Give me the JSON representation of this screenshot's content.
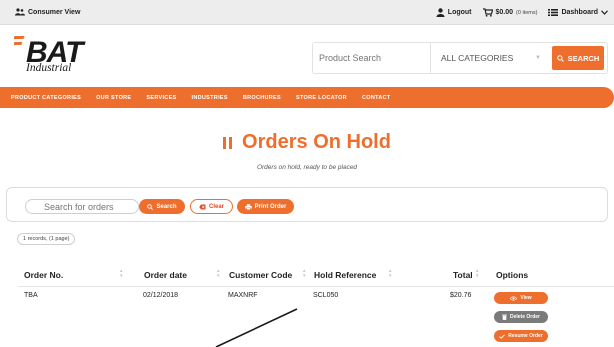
{
  "topbar": {
    "consumer_view": "Consumer View",
    "logout": "Logout",
    "cart_total": "$0.00",
    "cart_items": "(0 items)",
    "dashboard": "Dashboard"
  },
  "header": {
    "logo_text": "Industrial",
    "search_placeholder": "Product Search",
    "category_selected": "ALL CATEGORIES",
    "search_button": "SEARCH"
  },
  "nav": {
    "items": [
      "PRODUCT CATEGORIES",
      "OUR STORE",
      "SERVICES",
      "INDUSTRIES",
      "BROCHURES",
      "STORE LOCATOR",
      "CONTACT"
    ]
  },
  "page": {
    "title": "Orders On Hold",
    "subtitle": "Orders on hold, ready to be placed"
  },
  "filters": {
    "search_placeholder": "Search for orders",
    "search_button": "Search",
    "clear_button": "Clear",
    "print_button": "Print Order",
    "records_info": "1 records, (1 page)"
  },
  "table": {
    "headers": [
      "Order No.",
      "Order date",
      "Customer Code",
      "Hold Reference",
      "Total",
      "Options"
    ],
    "rows": [
      {
        "order_no": "TBA",
        "order_date": "02/12/2018",
        "customer_code": "MAXNRF",
        "hold_reference": "SCL050",
        "total": "$20.76",
        "actions": [
          "View",
          "Delete Order",
          "Resume Order"
        ]
      }
    ]
  },
  "colors": {
    "accent": "#ee6f2d",
    "delete_button": "#7a7a7a",
    "clear_text": "#e24a2a"
  }
}
